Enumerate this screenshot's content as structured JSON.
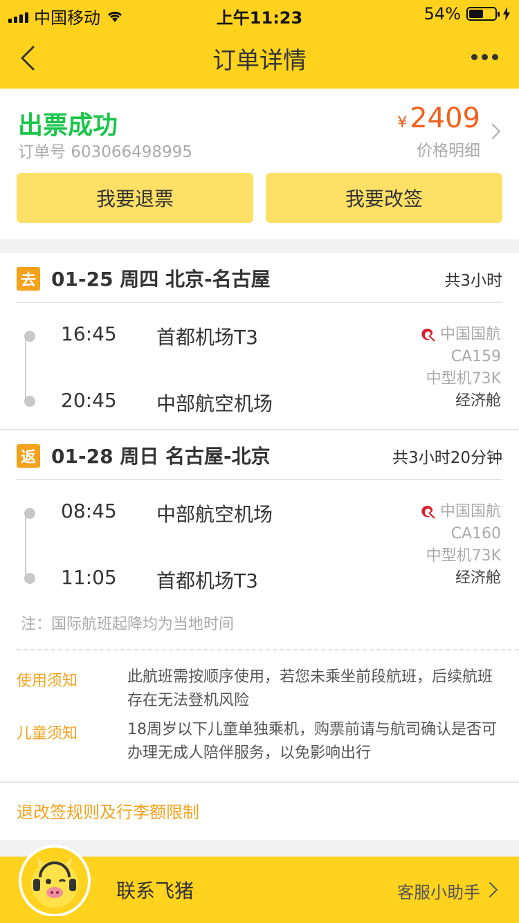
{
  "status_bar": {
    "carrier": "中国移动",
    "time": "上午11:23",
    "battery": "54%"
  },
  "nav": {
    "title": "订单详情"
  },
  "order": {
    "status": "出票成功",
    "order_no_label": "订单号 603066498995",
    "currency": "¥",
    "price": "2409",
    "price_detail_label": "价格明细",
    "refund_button": "我要退票",
    "change_button": "我要改签"
  },
  "trips": [
    {
      "tag": "去",
      "route": "01-25 周四 北京-名古屋",
      "duration": "共3小时",
      "depart_time": "16:45",
      "depart_airport": "首都机场T3",
      "arrive_time": "20:45",
      "arrive_airport": "中部航空机场",
      "airline": "中国国航",
      "flight_no": "CA159",
      "aircraft": "中型机73K",
      "cabin": "经济舱"
    },
    {
      "tag": "返",
      "route": "01-28 周日 名古屋-北京",
      "duration": "共3小时20分钟",
      "depart_time": "08:45",
      "depart_airport": "中部航空机场",
      "arrive_time": "11:05",
      "arrive_airport": "首都机场T3",
      "airline": "中国国航",
      "flight_no": "CA160",
      "aircraft": "中型机73K",
      "cabin": "经济舱"
    }
  ],
  "note": "注：国际航班起降均为当地时间",
  "notices": [
    {
      "label": "使用须知",
      "text": "此航班需按顺序使用，若您未乘坐前段航班，后续航班存在无法登机风险"
    },
    {
      "label": "儿童须知",
      "text": "18周岁以下儿童单独乘机，购票前请与航司确认是否可办理无成人陪伴服务，以免影响出行"
    }
  ],
  "rules_link": "退改签规则及行李额限制",
  "bottom": {
    "contact": "联系飞猪",
    "helper": "客服小助手"
  },
  "colors": {
    "brand_yellow": "#ffd21e",
    "success_green": "#19c54a",
    "price_orange": "#f2601b",
    "accent_orange": "#f4a11b"
  },
  "icons": [
    "back-icon",
    "more-icon",
    "wifi-icon",
    "battery-icon",
    "chevron-right-icon",
    "air-china-logo-icon",
    "fliggy-mascot-icon"
  ]
}
